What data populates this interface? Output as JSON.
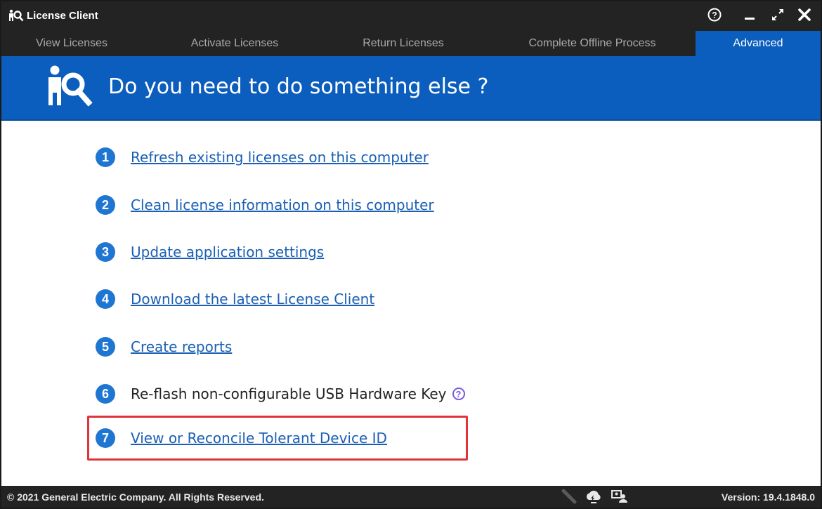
{
  "window": {
    "title": "License Client"
  },
  "tabs": [
    {
      "label": "View Licenses",
      "active": false
    },
    {
      "label": "Activate Licenses",
      "active": false
    },
    {
      "label": "Return Licenses",
      "active": false
    },
    {
      "label": "Complete Offline Process",
      "active": false
    },
    {
      "label": "Advanced",
      "active": true
    }
  ],
  "banner": {
    "title": "Do you need to do something else ?"
  },
  "options": [
    {
      "number": "1",
      "label": "Refresh existing licenses on this computer",
      "is_link": true
    },
    {
      "number": "2",
      "label": "Clean license information on this computer",
      "is_link": true
    },
    {
      "number": "3",
      "label": "Update application settings",
      "is_link": true
    },
    {
      "number": "4",
      "label": "Download the latest License Client",
      "is_link": true
    },
    {
      "number": "5",
      "label": "Create reports",
      "is_link": true
    },
    {
      "number": "6",
      "label": "Re-flash non-configurable USB Hardware Key",
      "is_link": false,
      "help_icon": "?"
    },
    {
      "number": "7",
      "label": "View or Reconcile Tolerant Device ID",
      "is_link": true,
      "highlighted": true
    }
  ],
  "status": {
    "copyright": "© 2021 General Electric Company. All Rights Reserved.",
    "version": "Version:  19.4.1848.0",
    "icons": [
      "usb-key-icon",
      "cloud-sync-icon",
      "user-connect-icon"
    ]
  },
  "controls": {
    "help": "?"
  },
  "colors": {
    "titlebar": "#232323",
    "accent": "#0b5ebd",
    "link": "#1a5fb4",
    "number_badge": "#1f76d2",
    "highlight_border": "#e0333a"
  }
}
